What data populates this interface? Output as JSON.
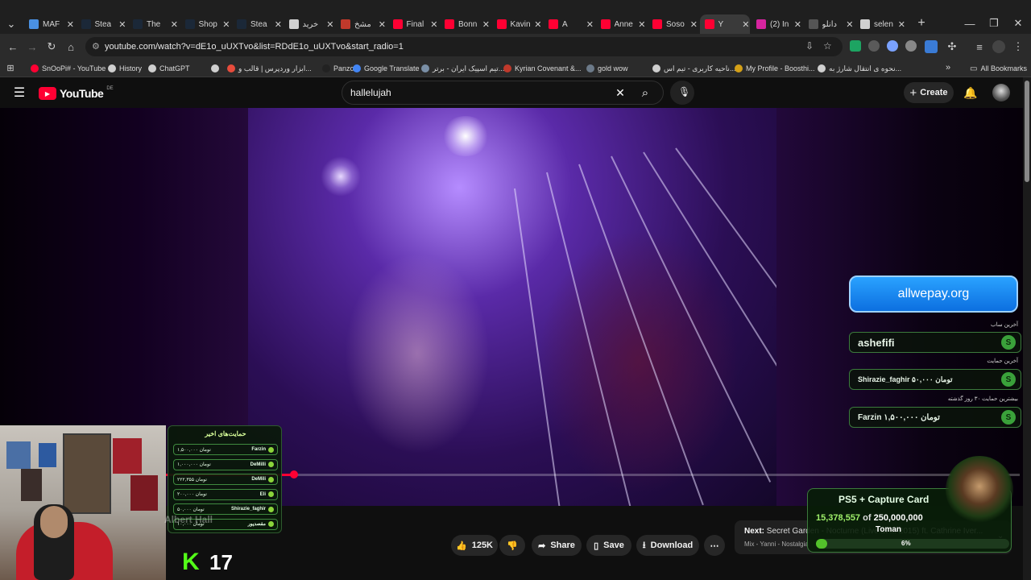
{
  "browser": {
    "tabs": [
      {
        "label": "MAF",
        "color": "#4a90e2"
      },
      {
        "label": "Stea",
        "color": "#1b2838"
      },
      {
        "label": "The",
        "color": "#1b2838"
      },
      {
        "label": "Shop",
        "color": "#1b2838"
      },
      {
        "label": "Stea",
        "color": "#1b2838"
      },
      {
        "label": "خرید",
        "color": "#d0d0d0"
      },
      {
        "label": "مشخ",
        "color": "#c0392b"
      },
      {
        "label": "Final",
        "color": "#ff0033"
      },
      {
        "label": "Bonn",
        "color": "#ff0033"
      },
      {
        "label": "Kavin",
        "color": "#ff0033"
      },
      {
        "label": "A",
        "color": "#ff0033"
      },
      {
        "label": "Anne",
        "color": "#ff0033"
      },
      {
        "label": "Soso",
        "color": "#ff0033"
      },
      {
        "label": "Y",
        "color": "#ff0033"
      },
      {
        "label": "(2) In",
        "color": "#d6249f"
      },
      {
        "label": "دانلو",
        "color": "#555"
      },
      {
        "label": "selen",
        "color": "#d0d0d0"
      }
    ],
    "url": "youtube.com/watch?v=dE1o_uUXTvo&list=RDdE1o_uUXTvo&start_radio=1",
    "bookmarks": [
      {
        "label": "SnOoPi# - YouTube",
        "color": "#ff0033"
      },
      {
        "label": "History",
        "color": "#cfcfcf"
      },
      {
        "label": "ChatGPT",
        "color": "#cfcfcf"
      },
      {
        "label": "",
        "color": "#cfcfcf"
      },
      {
        "label": "ابزار وردپرس | قالب و...",
        "color": "#e74c3c"
      },
      {
        "label": "Panzoid",
        "color": "#222"
      },
      {
        "label": "Google Translate",
        "color": "#4285f4"
      },
      {
        "label": "تیم اسپیک ایران - برتر...",
        "color": "#7a8fa6"
      },
      {
        "label": "Kyrian Covenant &...",
        "color": "#c0392b"
      },
      {
        "label": "gold wow",
        "color": "#6c7a89"
      },
      {
        "label": "ناحیه کاربری - تیم اس...",
        "color": "#cfcfcf"
      },
      {
        "label": "My Profile - Boosthi...",
        "color": "#d4a017"
      },
      {
        "label": "نحوه ی انتقال شارژ به...",
        "color": "#cfcfcf"
      }
    ],
    "all_bookmarks": "All Bookmarks"
  },
  "youtube": {
    "logo": "YouTube",
    "region": "DE",
    "search_value": "hallelujah",
    "create_label": "Create",
    "actions": {
      "likes": "125K",
      "share": "Share",
      "save": "Save",
      "download": "Download"
    },
    "next": {
      "label": "Next:",
      "title": "Secret Garden - Nocturne (Live at ... 2015) ft. Cathrine Iver...",
      "sub": "Mix - Yanni - Nostalgia"
    },
    "progress": 0.15
  },
  "overlay": {
    "allwepay": "allwepay.org",
    "latest_sub_label": "آخرین ساب",
    "latest_sub": "ashefifi",
    "latest_support_label": "آخرین حمایت",
    "latest_support": "Shirazie_faghir ۵۰,۰۰۰ تومان",
    "top_support_label": "بیشترین حمایت ۳۰ روز گذشته",
    "top_support": "Farzin ۱,۵۰۰,۰۰۰ تومان",
    "recent_title": "حمایت‌های اخیر",
    "recent": [
      {
        "name": "Farzin",
        "amount": "۱,۵۰۰,۰۰۰ تومان"
      },
      {
        "name": "DeMilli",
        "amount": "۱,۰۰۰,۰۰۰ تومان"
      },
      {
        "name": "DeMili",
        "amount": "۲۲۲,۳۵۵ تومان"
      },
      {
        "name": "Eli",
        "amount": "۲۰۰,۰۰۰ تومان"
      },
      {
        "name": "Shirazie_faghir",
        "amount": "۵۰,۰۰۰ تومان"
      },
      {
        "name": "مقصدپور",
        "amount": "۱۰,۰۰۰ تومان"
      }
    ],
    "watermark": "Albert Hall",
    "goal_title": "PS5 + Capture Card",
    "goal_current": "15,378,557",
    "goal_of": "of",
    "goal_target": "250,000,000",
    "goal_unit": "Toman",
    "goal_percent": "6%",
    "goal_progress": 0.06,
    "kick_logo": "K",
    "kick_count": "17"
  }
}
